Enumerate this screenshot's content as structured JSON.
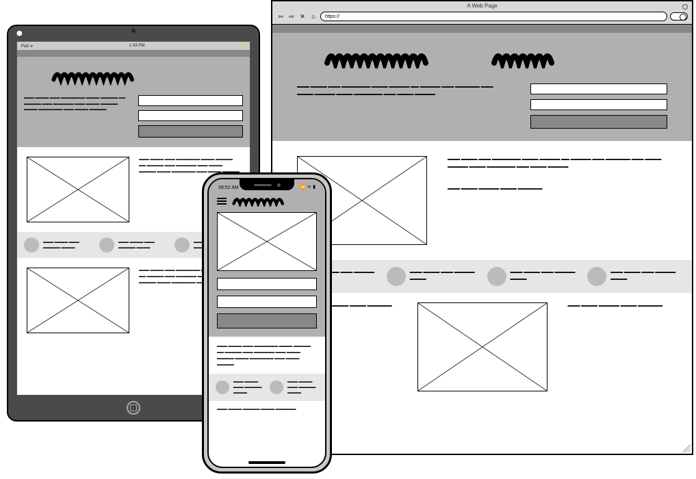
{
  "tablet": {
    "status_left": "Pad ᯤ",
    "status_time": "1:43 PM",
    "status_right": "⚡"
  },
  "browser": {
    "title": "A Web Page",
    "url_scheme": "https://"
  },
  "phone": {
    "time": "09:52 AM",
    "signal": "📶 ᯤ ▮"
  },
  "lorem_block": "▬▬▬ ▬▬▬▬ ▬▬▬ ▬▬▬▬▬▬▬ ▬▬▬▬ ▬▬▬▬▬ ▬▬ ▬▬▬▬▬ ▬▬▬ ▬▬▬▬▬▬ ▬▬▬ ▬▬▬▬ ▬▬▬▬▬ ▬▬▬▬ ▬▬▬▬▬▬▬ ▬▬▬ ▬▬▬▬ ▬▬▬▬▬",
  "lorem_short": "▬▬▬ ▬▬▬▬ ▬▬▬▬▬ ▬▬▬▬ ▬▬▬▬▬▬",
  "lorem_tiny": "▬▬▬ ▬▬▬▬ ▬▬▬ ▬▬▬▬▬ ▬▬▬▬"
}
